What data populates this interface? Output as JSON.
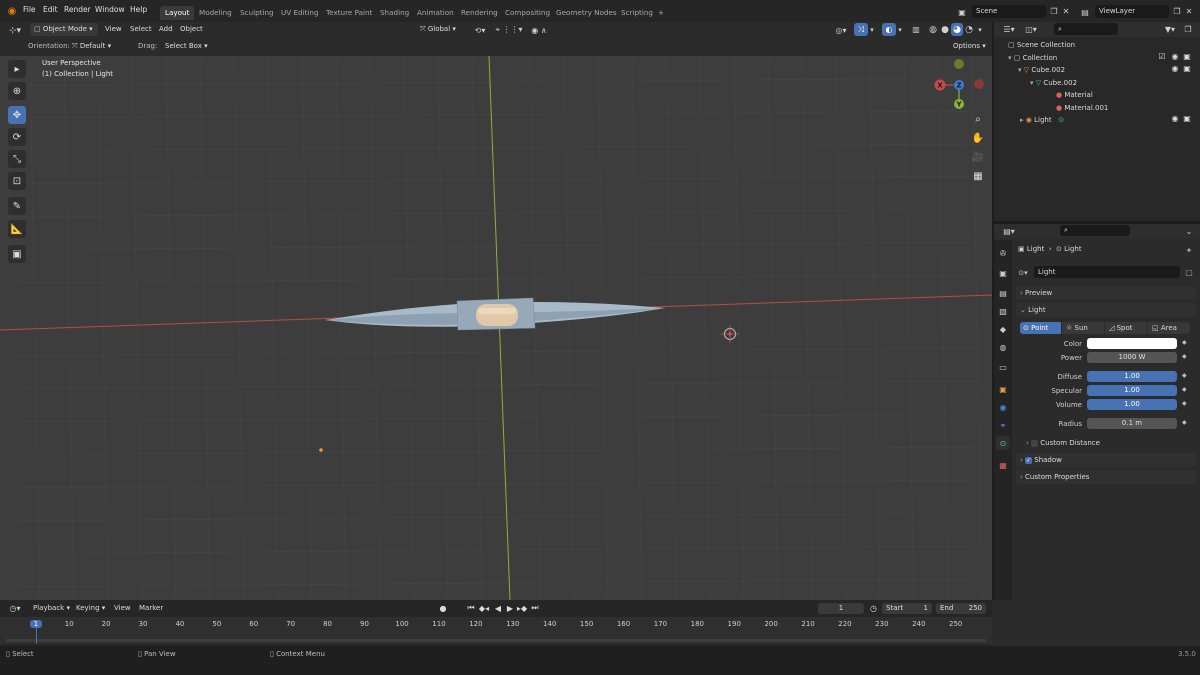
{
  "menu": [
    "File",
    "Edit",
    "Render",
    "Window",
    "Help"
  ],
  "workspaces": [
    "Layout",
    "Modeling",
    "Sculpting",
    "UV Editing",
    "Texture Paint",
    "Shading",
    "Animation",
    "Rendering",
    "Compositing",
    "Geometry Nodes",
    "Scripting"
  ],
  "add_tab": "+",
  "scene": "Scene",
  "view_layer": "ViewLayer",
  "viewport_header": {
    "mode": "Object Mode",
    "view": "View",
    "select": "Select",
    "add": "Add",
    "object": "Object",
    "transform": "Global",
    "orientation_label": "Orientation:",
    "orientation_value": "Default",
    "drag_label": "Drag:",
    "drag_value": "Select Box",
    "options": "Options"
  },
  "viewport": {
    "perspective": "User Perspective",
    "collection_info": "(1) Collection | Light",
    "axis_x": "X",
    "axis_y": "Y",
    "axis_z": "Z"
  },
  "outliner": {
    "rows": [
      {
        "label": "Scene Collection"
      },
      {
        "label": "Collection"
      },
      {
        "label": "Cube.002"
      },
      {
        "label": "Cube.002"
      },
      {
        "label": "Material"
      },
      {
        "label": "Material.001"
      },
      {
        "label": "Light"
      }
    ]
  },
  "properties": {
    "breadcrumb_object": "Light",
    "breadcrumb_data": "Light",
    "datablock": "Light",
    "preview": "Preview",
    "light_panel": "Light",
    "light_types": [
      "Point",
      "Sun",
      "Spot",
      "Area"
    ],
    "active_type": "Point",
    "color_label": "Color",
    "color_value": "#ffffff",
    "power_label": "Power",
    "power_value": "1000 W",
    "diffuse_label": "Diffuse",
    "diffuse_value": "1.00",
    "specular_label": "Specular",
    "specular_value": "1.00",
    "volume_label": "Volume",
    "volume_value": "1.00",
    "radius_label": "Radius",
    "radius_value": "0.1 m",
    "custom_distance": "Custom Distance",
    "custom_distance_checked": false,
    "shadow": "Shadow",
    "shadow_checked": true,
    "custom_properties": "Custom Properties"
  },
  "timeline": {
    "playback": "Playback",
    "keying": "Keying",
    "view": "View",
    "marker": "Marker",
    "current_frame": "1",
    "start_label": "Start",
    "start_value": "1",
    "end_label": "End",
    "end_value": "250",
    "ticks": [
      "1",
      "10",
      "20",
      "30",
      "40",
      "50",
      "60",
      "70",
      "80",
      "90",
      "100",
      "110",
      "120",
      "130",
      "140",
      "150",
      "160",
      "170",
      "180",
      "190",
      "200",
      "210",
      "220",
      "230",
      "240",
      "250"
    ]
  },
  "status": {
    "select": "Select",
    "pan": "Pan View",
    "context": "Context Menu",
    "version": "3.5.0"
  },
  "colors": {
    "accent": "#4772b3",
    "axis_x": "#c84a4a",
    "axis_y": "#8ab33a",
    "axis_z": "#3d7bd6",
    "viewport_bg": "#3d3d3d"
  }
}
